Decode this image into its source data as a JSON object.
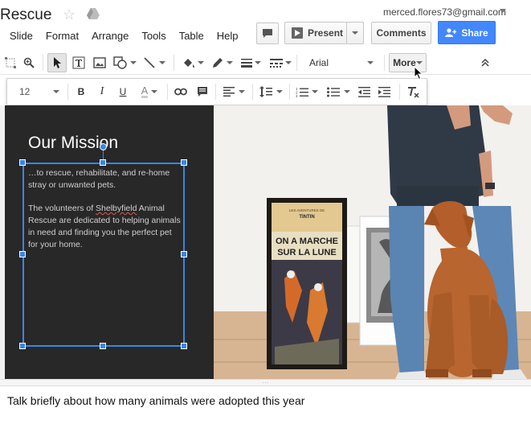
{
  "doc": {
    "title": "Rescue"
  },
  "account": {
    "email": "merced.flores73@gmail.com"
  },
  "menu": [
    "Slide",
    "Format",
    "Arrange",
    "Tools",
    "Table",
    "Help"
  ],
  "header_buttons": {
    "present": "Present",
    "comments": "Comments",
    "share": "Share"
  },
  "toolbar": {
    "font": "Arial",
    "more": "More",
    "font_size": "12",
    "bold": "B",
    "italic": "I",
    "underline": "U",
    "text_color": "A"
  },
  "slide": {
    "title": "Our Mission",
    "para1": "…to rescue, rehabilitate, and re-home stray or unwanted pets.",
    "para2_before": "The volunteers of ",
    "para2_highlight": "Shelbyfield",
    "para2_after": " Animal Rescue are dedicated to helping animals in need and finding you the perfect pet for your home.",
    "poster_line1": "ON A MARCHE",
    "poster_line2": "SUR LA LUNE",
    "poster_small": "LES AVENTURES DE",
    "poster_tintin": "TINTIN"
  },
  "notes": {
    "text": "Talk briefly about how many animals were adopted this year"
  },
  "colors": {
    "accent": "#3b86e0",
    "share": "#4387fd",
    "slide_bg": "#282828"
  }
}
